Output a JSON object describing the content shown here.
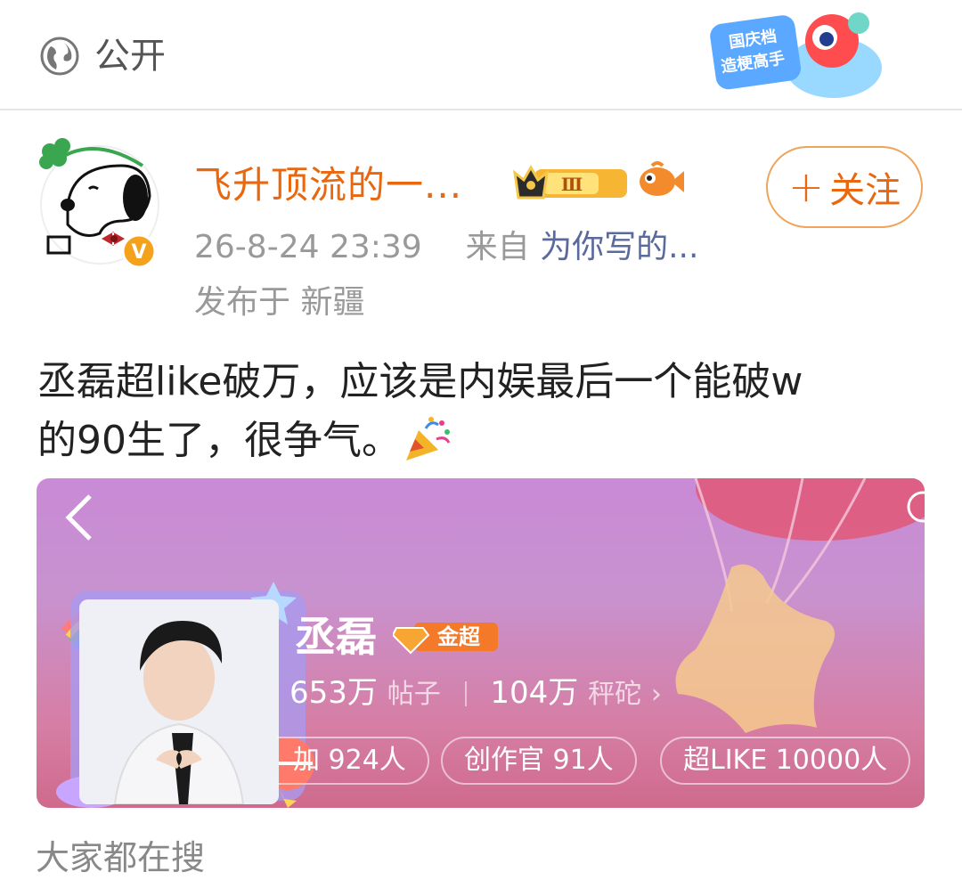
{
  "header": {
    "visibility": "公开",
    "visibility_icon": "globe-icon",
    "promo_badge": {
      "line1": "国庆档",
      "line2": "造梗高手"
    }
  },
  "post": {
    "username": "飞升顶流的一...",
    "level_badge": "Ⅲ",
    "follow_label": "关注",
    "time": "26-8-24 23:39",
    "from_label": "来自",
    "source": "为你写的...",
    "location": "发布于 新疆",
    "text_line1": "丞磊超like破万，应该是内娱最后一个能破w",
    "text_line2": "的90生了，很争气。"
  },
  "card": {
    "name": "丞磊",
    "badge_label": "金超",
    "posts_count": "653万",
    "posts_label": "帖子",
    "weights_count": "104万",
    "weights_label": "秤砣",
    "pills": [
      {
        "label": "加 924人"
      },
      {
        "label": "创作官 91人"
      },
      {
        "label": "超LIKE 10000人"
      }
    ]
  },
  "footer": {
    "search_label": "大家都在搜"
  },
  "colors": {
    "accent": "#e8670f",
    "link": "#5b6a9e",
    "meta": "#999999"
  }
}
